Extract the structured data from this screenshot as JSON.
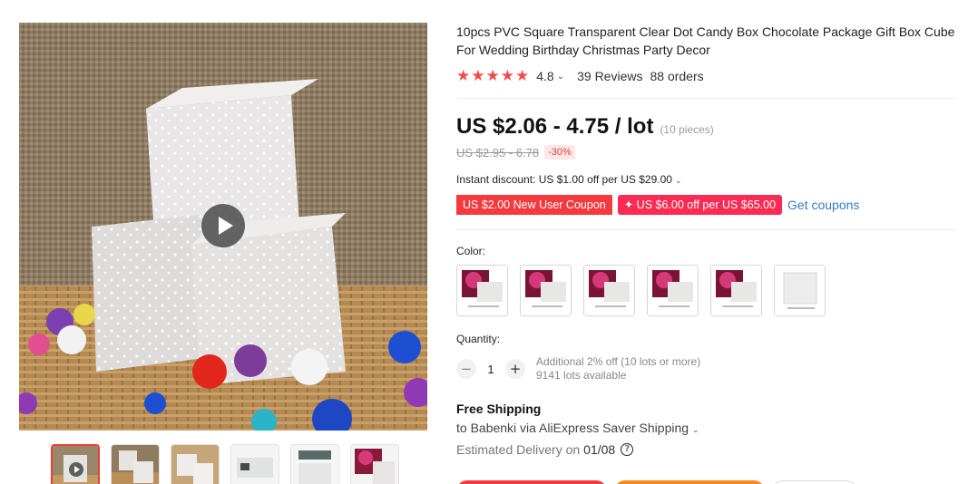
{
  "product": {
    "title": "10pcs PVC Square Transparent Clear Dot Candy Box Chocolate Package Gift Box Cube For Wedding Birthday Christmas Party Decor",
    "rating": "4.8",
    "rating_value": 4.8,
    "reviews": "39 Reviews",
    "orders": "88 orders"
  },
  "price": {
    "current": "US $2.06 - 4.75 / lot",
    "pieces": "(10 pieces)",
    "original": "US $2.95 - 6.78",
    "discount": "-30%"
  },
  "promotions": {
    "instant_discount": "Instant discount: US $1.00 off per US $29.00",
    "coupon_new_user": "US $2.00 New User Coupon",
    "coupon_store": "✦ US $6.00 off per US $65.00",
    "get_coupons": "Get coupons"
  },
  "options": {
    "color_label": "Color:",
    "swatches": [
      {
        "name": "photo variant 1"
      },
      {
        "name": "photo variant 2"
      },
      {
        "name": "photo variant 3"
      },
      {
        "name": "photo variant 4"
      },
      {
        "name": "photo variant 5"
      },
      {
        "name": "clear box"
      }
    ]
  },
  "quantity": {
    "label": "Quantity:",
    "value": "1",
    "minus": "−",
    "plus": "+",
    "bulk_note": "Additional 2% off (10 lots or more)",
    "available": "9141 lots available"
  },
  "shipping": {
    "free": "Free Shipping",
    "to": "to Babenki via AliExpress Saver Shipping",
    "estimated_label": "Estimated Delivery on",
    "estimated_date": "01/08",
    "help": "?"
  },
  "icons": {
    "star": "★",
    "chevron": "⌄"
  },
  "colors": {
    "accent_red": "#f53a3f",
    "coupon_pink": "#fb2b54",
    "link_blue": "#3a7bbf",
    "star_red": "#f44b4b",
    "cart_orange": "#fa8a1f"
  }
}
